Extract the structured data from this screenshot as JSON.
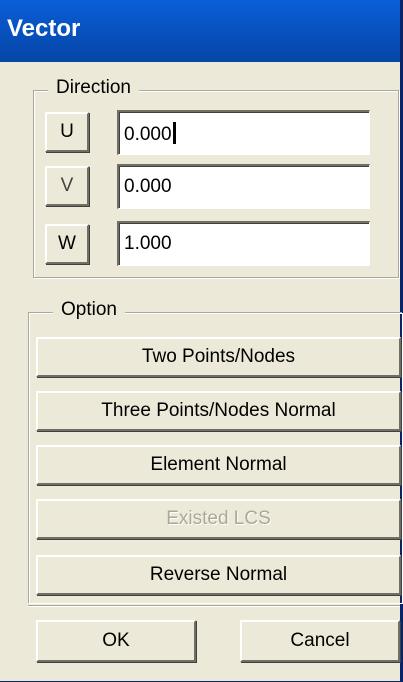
{
  "window": {
    "title": "Vector"
  },
  "direction": {
    "legend": "Direction",
    "axes": [
      {
        "button": "U",
        "value": "0.000"
      },
      {
        "button": "V",
        "value": "0.000"
      },
      {
        "button": "W",
        "value": "1.000"
      }
    ]
  },
  "option": {
    "legend": "Option",
    "buttons": [
      {
        "label": "Two Points/Nodes",
        "enabled": true
      },
      {
        "label": "Three Points/Nodes Normal",
        "enabled": true
      },
      {
        "label": "Element Normal",
        "enabled": true
      },
      {
        "label": "Existed LCS",
        "enabled": false
      },
      {
        "label": "Reverse Normal",
        "enabled": true
      }
    ]
  },
  "footer": {
    "ok_label": "OK",
    "cancel_label": "Cancel"
  }
}
